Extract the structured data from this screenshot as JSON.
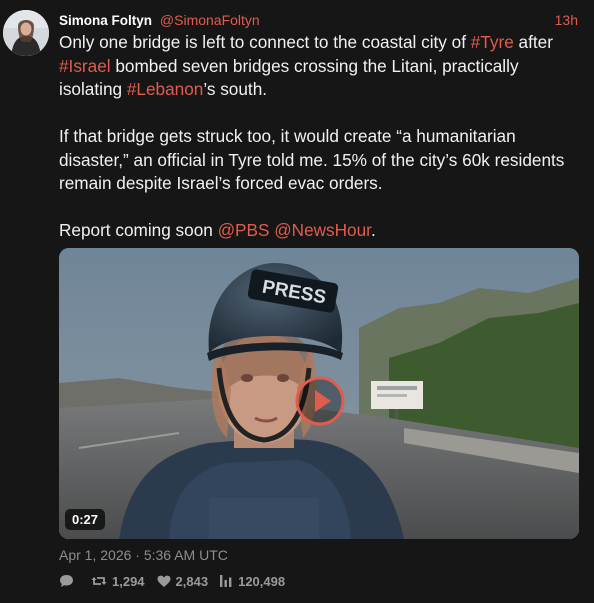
{
  "author": {
    "name": "Simona Foltyn",
    "handle": "@SimonaFoltyn",
    "time": "13h"
  },
  "paragraphs": [
    [
      {
        "t": "Only one bridge is left to connect to the coastal city of "
      },
      {
        "t": "#Tyre",
        "link": true
      },
      {
        "t": " after "
      },
      {
        "t": "#Israel",
        "link": true
      },
      {
        "t": " bombed seven bridges crossing the Litani, practically isolating "
      },
      {
        "t": "#Lebanon",
        "link": true
      },
      {
        "t": "’s south."
      }
    ],
    [
      {
        "t": "If that bridge gets struck too, it would create “a humanitarian disaster,” an official in Tyre told me. 15% of the city’s 60k residents remain despite Israel’s forced evac orders."
      }
    ],
    [
      {
        "t": "Report coming soon "
      },
      {
        "t": "@PBS",
        "link": true
      },
      {
        "t": " "
      },
      {
        "t": "@NewsHour",
        "link": true
      },
      {
        "t": "."
      }
    ]
  ],
  "media": {
    "duration": "0:27",
    "helmet_text": "PRESS",
    "play_icon": "play-icon"
  },
  "meta": {
    "date": "Apr 1, 2026",
    "separator": "·",
    "time": "5:36 AM UTC"
  },
  "stats": {
    "reply_icon": "comment-icon",
    "retweets": "1,294",
    "likes": "2,843",
    "views": "120,498"
  },
  "colors": {
    "background": "#161616",
    "accent": "#e15c4e",
    "text": "#f1f1f1",
    "muted": "#8d8d8d"
  }
}
